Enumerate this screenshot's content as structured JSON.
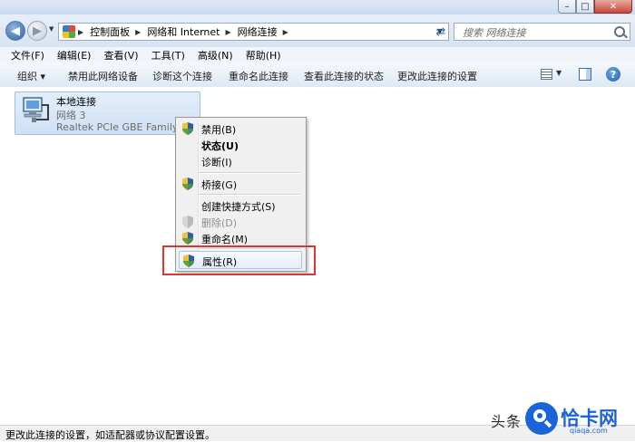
{
  "window": {
    "caption_min": "–",
    "caption_max": "□",
    "caption_close": "✕"
  },
  "navigation": {
    "breadcrumbs": [
      "控制面板",
      "网络和 Internet",
      "网络连接"
    ],
    "search_placeholder": "搜索 网络连接"
  },
  "menubar": [
    "文件(F)",
    "编辑(E)",
    "查看(V)",
    "工具(T)",
    "高级(N)",
    "帮助(H)"
  ],
  "commandbar": {
    "organize": "组织 ▾",
    "disable": "禁用此网络设备",
    "diagnose": "诊断这个连接",
    "rename": "重命名此连接",
    "view_status": "查看此连接的状态",
    "change_settings": "更改此连接的设置",
    "help": "?"
  },
  "connection": {
    "name": "本地连接",
    "network": "网络  3",
    "adapter": "Realtek PCIe GBE Family Co"
  },
  "context_menu": {
    "disable": "禁用(B)",
    "status": "状态(U)",
    "diagnose": "诊断(I)",
    "bridge": "桥接(G)",
    "shortcut": "创建快捷方式(S)",
    "delete": "删除(D)",
    "rename": "重命名(M)",
    "properties": "属性(R)"
  },
  "statusbar": {
    "text": "更改此连接的设置，如适配器或协议配置设置。"
  },
  "watermark": {
    "prefix": "头条",
    "brand": "恰卡网",
    "domain": "qiaqa.com"
  },
  "colors": {
    "highlight_box": "#e0342f",
    "selection": "#cfe1f5",
    "brand": "#1a63d8"
  }
}
